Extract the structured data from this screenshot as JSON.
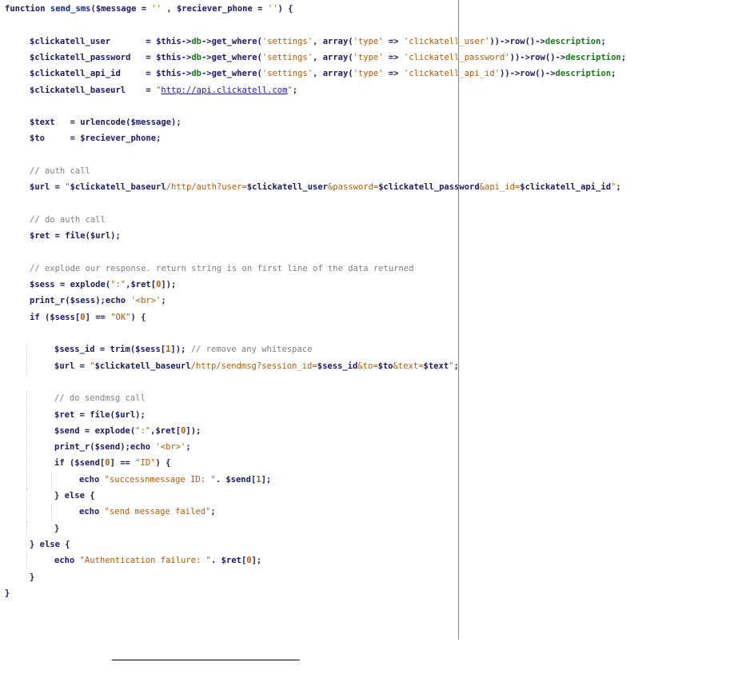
{
  "code_lines": [
    {
      "indent": 0,
      "tokens": [
        {
          "t": "kw",
          "v": "function "
        },
        {
          "t": "fn",
          "v": "send_sms"
        },
        {
          "t": "op",
          "v": "("
        },
        {
          "t": "var",
          "v": "$message"
        },
        {
          "t": "op",
          "v": " = "
        },
        {
          "t": "str",
          "v": "''"
        },
        {
          "t": "op",
          "v": " , "
        },
        {
          "t": "var",
          "v": "$reciever_phone"
        },
        {
          "t": "op",
          "v": " = "
        },
        {
          "t": "str",
          "v": "''"
        },
        {
          "t": "op",
          "v": ") {"
        }
      ]
    },
    {
      "indent": 0,
      "tokens": []
    },
    {
      "indent": 1,
      "tokens": [
        {
          "t": "var",
          "v": "$clickatell_user       "
        },
        {
          "t": "op",
          "v": "= "
        },
        {
          "t": "var",
          "v": "$this"
        },
        {
          "t": "op",
          "v": "->"
        },
        {
          "t": "prop",
          "v": "db"
        },
        {
          "t": "op",
          "v": "->get_where("
        },
        {
          "t": "str",
          "v": "'settings'"
        },
        {
          "t": "op",
          "v": ", array("
        },
        {
          "t": "str",
          "v": "'type'"
        },
        {
          "t": "op",
          "v": " => "
        },
        {
          "t": "str",
          "v": "'clickatell_user'"
        },
        {
          "t": "op",
          "v": "))->row()->"
        },
        {
          "t": "prop",
          "v": "description"
        },
        {
          "t": "op",
          "v": ";"
        }
      ]
    },
    {
      "indent": 1,
      "tokens": [
        {
          "t": "var",
          "v": "$clickatell_password   "
        },
        {
          "t": "op",
          "v": "= "
        },
        {
          "t": "var",
          "v": "$this"
        },
        {
          "t": "op",
          "v": "->"
        },
        {
          "t": "prop",
          "v": "db"
        },
        {
          "t": "op",
          "v": "->get_where("
        },
        {
          "t": "str",
          "v": "'settings'"
        },
        {
          "t": "op",
          "v": ", array("
        },
        {
          "t": "str",
          "v": "'type'"
        },
        {
          "t": "op",
          "v": " => "
        },
        {
          "t": "str",
          "v": "'clickatell_password'"
        },
        {
          "t": "op",
          "v": "))->row()->"
        },
        {
          "t": "prop",
          "v": "description"
        },
        {
          "t": "op",
          "v": ";"
        }
      ]
    },
    {
      "indent": 1,
      "tokens": [
        {
          "t": "var",
          "v": "$clickatell_api_id     "
        },
        {
          "t": "op",
          "v": "= "
        },
        {
          "t": "var",
          "v": "$this"
        },
        {
          "t": "op",
          "v": "->"
        },
        {
          "t": "prop",
          "v": "db"
        },
        {
          "t": "op",
          "v": "->get_where("
        },
        {
          "t": "str",
          "v": "'settings'"
        },
        {
          "t": "op",
          "v": ", array("
        },
        {
          "t": "str",
          "v": "'type'"
        },
        {
          "t": "op",
          "v": " => "
        },
        {
          "t": "str",
          "v": "'clickatell_api_id'"
        },
        {
          "t": "op",
          "v": "))->row()->"
        },
        {
          "t": "prop",
          "v": "description"
        },
        {
          "t": "op",
          "v": ";"
        }
      ]
    },
    {
      "indent": 1,
      "tokens": [
        {
          "t": "var",
          "v": "$clickatell_baseurl    "
        },
        {
          "t": "op",
          "v": "= "
        },
        {
          "t": "str",
          "v": "\""
        },
        {
          "t": "url",
          "v": "http://api.clickatell.com"
        },
        {
          "t": "str",
          "v": "\""
        },
        {
          "t": "op",
          "v": ";"
        }
      ]
    },
    {
      "indent": 0,
      "tokens": []
    },
    {
      "indent": 1,
      "tokens": [
        {
          "t": "var",
          "v": "$text   "
        },
        {
          "t": "op",
          "v": "= urlencode("
        },
        {
          "t": "var",
          "v": "$message"
        },
        {
          "t": "op",
          "v": ");"
        }
      ]
    },
    {
      "indent": 1,
      "tokens": [
        {
          "t": "var",
          "v": "$to     "
        },
        {
          "t": "op",
          "v": "= "
        },
        {
          "t": "var",
          "v": "$reciever_phone"
        },
        {
          "t": "op",
          "v": ";"
        }
      ]
    },
    {
      "indent": 0,
      "tokens": []
    },
    {
      "indent": 1,
      "tokens": [
        {
          "t": "comment",
          "v": "// auth call"
        }
      ]
    },
    {
      "indent": 1,
      "tokens": [
        {
          "t": "var",
          "v": "$url"
        },
        {
          "t": "op",
          "v": " = "
        },
        {
          "t": "str",
          "v": "\""
        },
        {
          "t": "var",
          "v": "$clickatell_baseurl"
        },
        {
          "t": "str",
          "v": "/http/auth?user="
        },
        {
          "t": "var",
          "v": "$clickatell_user"
        },
        {
          "t": "str",
          "v": "&password="
        },
        {
          "t": "var",
          "v": "$clickatell_password"
        },
        {
          "t": "str",
          "v": "&api_id="
        },
        {
          "t": "var",
          "v": "$clickatell_api_id"
        },
        {
          "t": "str",
          "v": "\""
        },
        {
          "t": "op",
          "v": ";"
        }
      ]
    },
    {
      "indent": 0,
      "tokens": []
    },
    {
      "indent": 1,
      "tokens": [
        {
          "t": "comment",
          "v": "// do auth call"
        }
      ]
    },
    {
      "indent": 1,
      "tokens": [
        {
          "t": "var",
          "v": "$ret"
        },
        {
          "t": "op",
          "v": " = file("
        },
        {
          "t": "var",
          "v": "$url"
        },
        {
          "t": "op",
          "v": ");"
        }
      ]
    },
    {
      "indent": 0,
      "tokens": []
    },
    {
      "indent": 1,
      "tokens": [
        {
          "t": "comment",
          "v": "// explode our response. return string is on first line of the data returned"
        }
      ]
    },
    {
      "indent": 1,
      "tokens": [
        {
          "t": "var",
          "v": "$sess"
        },
        {
          "t": "op",
          "v": " = explode("
        },
        {
          "t": "str",
          "v": "\":\""
        },
        {
          "t": "op",
          "v": ","
        },
        {
          "t": "var",
          "v": "$ret"
        },
        {
          "t": "op",
          "v": "["
        },
        {
          "t": "num",
          "v": "0"
        },
        {
          "t": "op",
          "v": "]);"
        }
      ]
    },
    {
      "indent": 1,
      "tokens": [
        {
          "t": "op",
          "v": "print_r("
        },
        {
          "t": "var",
          "v": "$sess"
        },
        {
          "t": "op",
          "v": ");echo "
        },
        {
          "t": "str",
          "v": "'<br>'"
        },
        {
          "t": "op",
          "v": ";"
        }
      ]
    },
    {
      "indent": 1,
      "tokens": [
        {
          "t": "kw",
          "v": "if"
        },
        {
          "t": "op",
          "v": " ("
        },
        {
          "t": "var",
          "v": "$sess"
        },
        {
          "t": "op",
          "v": "["
        },
        {
          "t": "num",
          "v": "0"
        },
        {
          "t": "op",
          "v": "] == "
        },
        {
          "t": "str",
          "v": "\"OK\""
        },
        {
          "t": "op",
          "v": ") {"
        }
      ]
    },
    {
      "indent": 0,
      "tokens": []
    },
    {
      "indent": 2,
      "tokens": [
        {
          "t": "var",
          "v": "$sess_id"
        },
        {
          "t": "op",
          "v": " = trim("
        },
        {
          "t": "var",
          "v": "$sess"
        },
        {
          "t": "op",
          "v": "["
        },
        {
          "t": "num",
          "v": "1"
        },
        {
          "t": "op",
          "v": "]); "
        },
        {
          "t": "comment",
          "v": "// remove any whitespace"
        }
      ]
    },
    {
      "indent": 2,
      "tokens": [
        {
          "t": "var",
          "v": "$url"
        },
        {
          "t": "op",
          "v": " = "
        },
        {
          "t": "str",
          "v": "\""
        },
        {
          "t": "var",
          "v": "$clickatell_baseurl"
        },
        {
          "t": "str",
          "v": "/http/sendmsg?session_id="
        },
        {
          "t": "var",
          "v": "$sess_id"
        },
        {
          "t": "str",
          "v": "&to="
        },
        {
          "t": "var",
          "v": "$to"
        },
        {
          "t": "str",
          "v": "&text="
        },
        {
          "t": "var",
          "v": "$text"
        },
        {
          "t": "str",
          "v": "\""
        },
        {
          "t": "op",
          "v": ";"
        }
      ]
    },
    {
      "indent": 0,
      "tokens": []
    },
    {
      "indent": 2,
      "tokens": [
        {
          "t": "comment",
          "v": "// do sendmsg call"
        }
      ]
    },
    {
      "indent": 2,
      "tokens": [
        {
          "t": "var",
          "v": "$ret"
        },
        {
          "t": "op",
          "v": " = file("
        },
        {
          "t": "var",
          "v": "$url"
        },
        {
          "t": "op",
          "v": ");"
        }
      ]
    },
    {
      "indent": 2,
      "tokens": [
        {
          "t": "var",
          "v": "$send"
        },
        {
          "t": "op",
          "v": " = explode("
        },
        {
          "t": "str",
          "v": "\":\""
        },
        {
          "t": "op",
          "v": ","
        },
        {
          "t": "var",
          "v": "$ret"
        },
        {
          "t": "op",
          "v": "["
        },
        {
          "t": "num",
          "v": "0"
        },
        {
          "t": "op",
          "v": "]);"
        }
      ]
    },
    {
      "indent": 2,
      "tokens": [
        {
          "t": "op",
          "v": "print_r("
        },
        {
          "t": "var",
          "v": "$send"
        },
        {
          "t": "op",
          "v": ");echo "
        },
        {
          "t": "str",
          "v": "'<br>'"
        },
        {
          "t": "op",
          "v": ";"
        }
      ]
    },
    {
      "indent": 2,
      "tokens": [
        {
          "t": "kw",
          "v": "if"
        },
        {
          "t": "op",
          "v": " ("
        },
        {
          "t": "var",
          "v": "$send"
        },
        {
          "t": "op",
          "v": "["
        },
        {
          "t": "num",
          "v": "0"
        },
        {
          "t": "op",
          "v": "] == "
        },
        {
          "t": "str",
          "v": "\"ID\""
        },
        {
          "t": "op",
          "v": ") {"
        }
      ]
    },
    {
      "indent": 3,
      "tokens": [
        {
          "t": "kw",
          "v": "echo "
        },
        {
          "t": "str",
          "v": "\"successnmessage ID: \""
        },
        {
          "t": "op",
          "v": ". "
        },
        {
          "t": "var",
          "v": "$send"
        },
        {
          "t": "op",
          "v": "["
        },
        {
          "t": "num",
          "v": "1"
        },
        {
          "t": "op",
          "v": "];"
        }
      ]
    },
    {
      "indent": 2,
      "tokens": [
        {
          "t": "op",
          "v": "} "
        },
        {
          "t": "kw",
          "v": "else"
        },
        {
          "t": "op",
          "v": " {"
        }
      ]
    },
    {
      "indent": 3,
      "tokens": [
        {
          "t": "kw",
          "v": "echo "
        },
        {
          "t": "str",
          "v": "\"send message failed\""
        },
        {
          "t": "op",
          "v": ";"
        }
      ]
    },
    {
      "indent": 2,
      "tokens": [
        {
          "t": "op",
          "v": "}"
        }
      ]
    },
    {
      "indent": 1,
      "tokens": [
        {
          "t": "op",
          "v": "} "
        },
        {
          "t": "kw",
          "v": "else"
        },
        {
          "t": "op",
          "v": " {"
        }
      ]
    },
    {
      "indent": 2,
      "tokens": [
        {
          "t": "kw",
          "v": "echo "
        },
        {
          "t": "str",
          "v": "\"Authentication failure: \""
        },
        {
          "t": "op",
          "v": ". "
        },
        {
          "t": "var",
          "v": "$ret"
        },
        {
          "t": "op",
          "v": "["
        },
        {
          "t": "num",
          "v": "0"
        },
        {
          "t": "op",
          "v": "];"
        }
      ]
    },
    {
      "indent": 1,
      "tokens": [
        {
          "t": "op",
          "v": "}"
        }
      ]
    },
    {
      "indent": 0,
      "tokens": [
        {
          "t": "op",
          "v": "}"
        }
      ]
    }
  ]
}
